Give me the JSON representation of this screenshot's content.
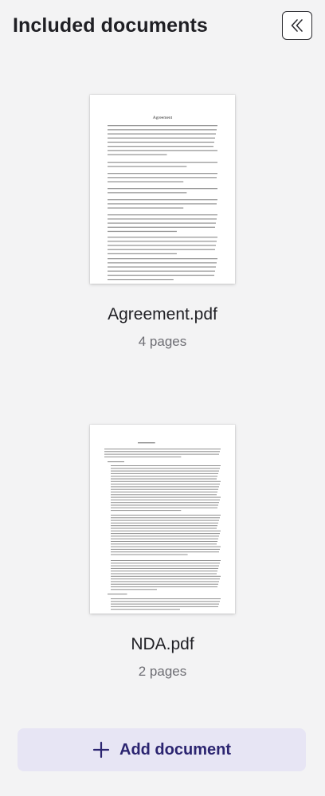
{
  "panel": {
    "title": "Included documents",
    "collapse_icon": "double-chevron-left-icon"
  },
  "documents": [
    {
      "name": "Agreement.pdf",
      "pages": "4 pages",
      "thumbnail_heading": "Agreement"
    },
    {
      "name": "NDA.pdf",
      "pages": "2 pages"
    }
  ],
  "add_button": {
    "label": "Add document",
    "icon": "plus-icon"
  },
  "colors": {
    "background": "#f3f3f4",
    "accent": "#2b2470",
    "button_bg": "#e7e5f4"
  }
}
